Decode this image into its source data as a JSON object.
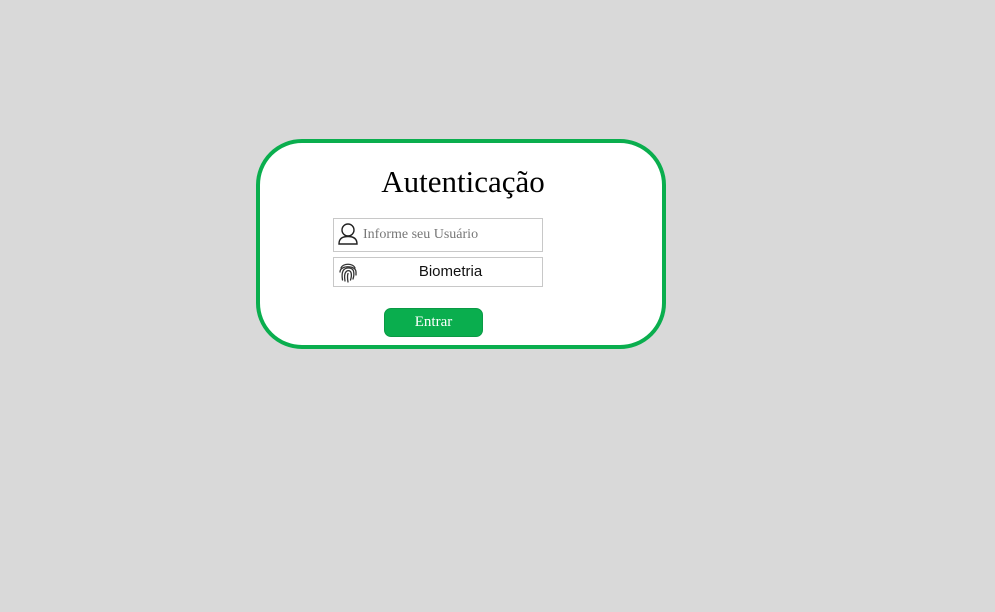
{
  "login": {
    "title": "Autenticação",
    "username_placeholder": "Informe seu Usuário",
    "username_value": "",
    "biometrics_label": "Biometria",
    "submit_label": "Entrar"
  },
  "icons": {
    "username": "user-icon",
    "biometrics": "fingerprint-icon"
  },
  "colors": {
    "accent": "#0aae4e",
    "background": "#d9d9d9",
    "card": "#ffffff"
  }
}
